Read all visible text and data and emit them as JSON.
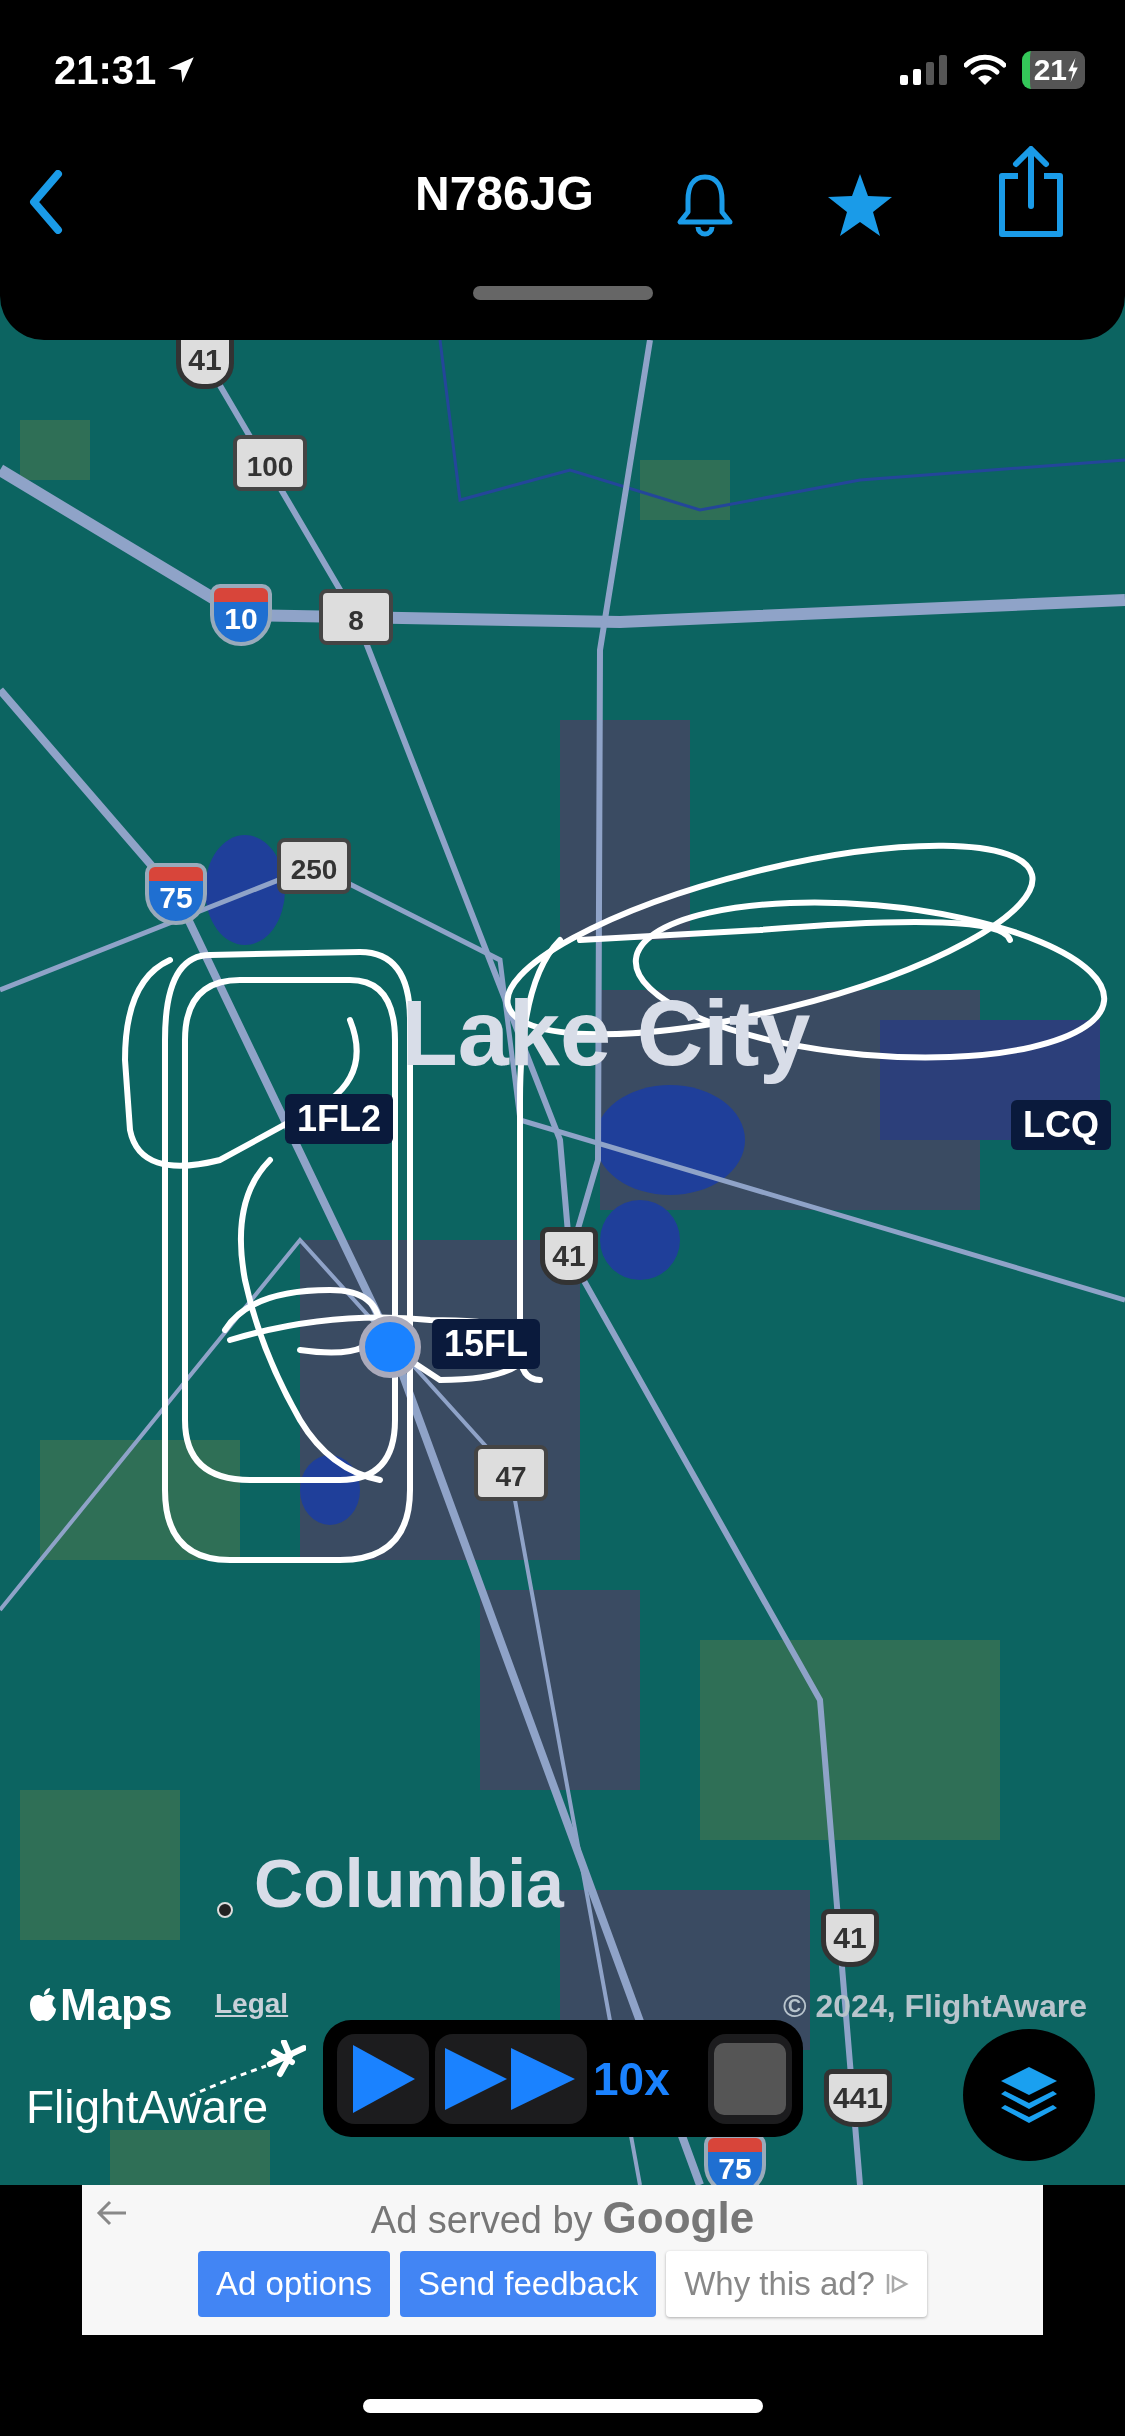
{
  "status_bar": {
    "time": "21:31",
    "battery": "21"
  },
  "nav": {
    "title": "N786JG"
  },
  "map": {
    "shields": [
      {
        "kind": "us",
        "label": "41"
      },
      {
        "kind": "state",
        "label": "100"
      },
      {
        "kind": "interstate",
        "label": "10"
      },
      {
        "kind": "state",
        "label": "8"
      },
      {
        "kind": "state",
        "label": "250"
      },
      {
        "kind": "interstate",
        "label": "75"
      },
      {
        "kind": "us",
        "label": "41"
      },
      {
        "kind": "state",
        "label": "47"
      },
      {
        "kind": "us",
        "label": "41"
      },
      {
        "kind": "us",
        "label": "441"
      },
      {
        "kind": "interstate",
        "label": "75"
      }
    ],
    "places": [
      {
        "kind": "city",
        "label": "Lake City"
      },
      {
        "kind": "town",
        "label": "Columbia"
      }
    ],
    "airports": [
      {
        "label": "1FL2"
      },
      {
        "label": "LCQ"
      },
      {
        "label": "15FL"
      }
    ],
    "maps_brand": "Maps",
    "legal": "Legal",
    "copyright": "© 2024, FlightAware",
    "logo": "FlightAware"
  },
  "playback": {
    "speed": "10x"
  },
  "ad": {
    "served_by": "Ad served by",
    "brand": "Google",
    "buttons": [
      {
        "label": "Ad options",
        "kind": "primary"
      },
      {
        "label": "Send feedback",
        "kind": "primary"
      },
      {
        "label": "Why this ad?",
        "kind": "secondary"
      }
    ]
  }
}
